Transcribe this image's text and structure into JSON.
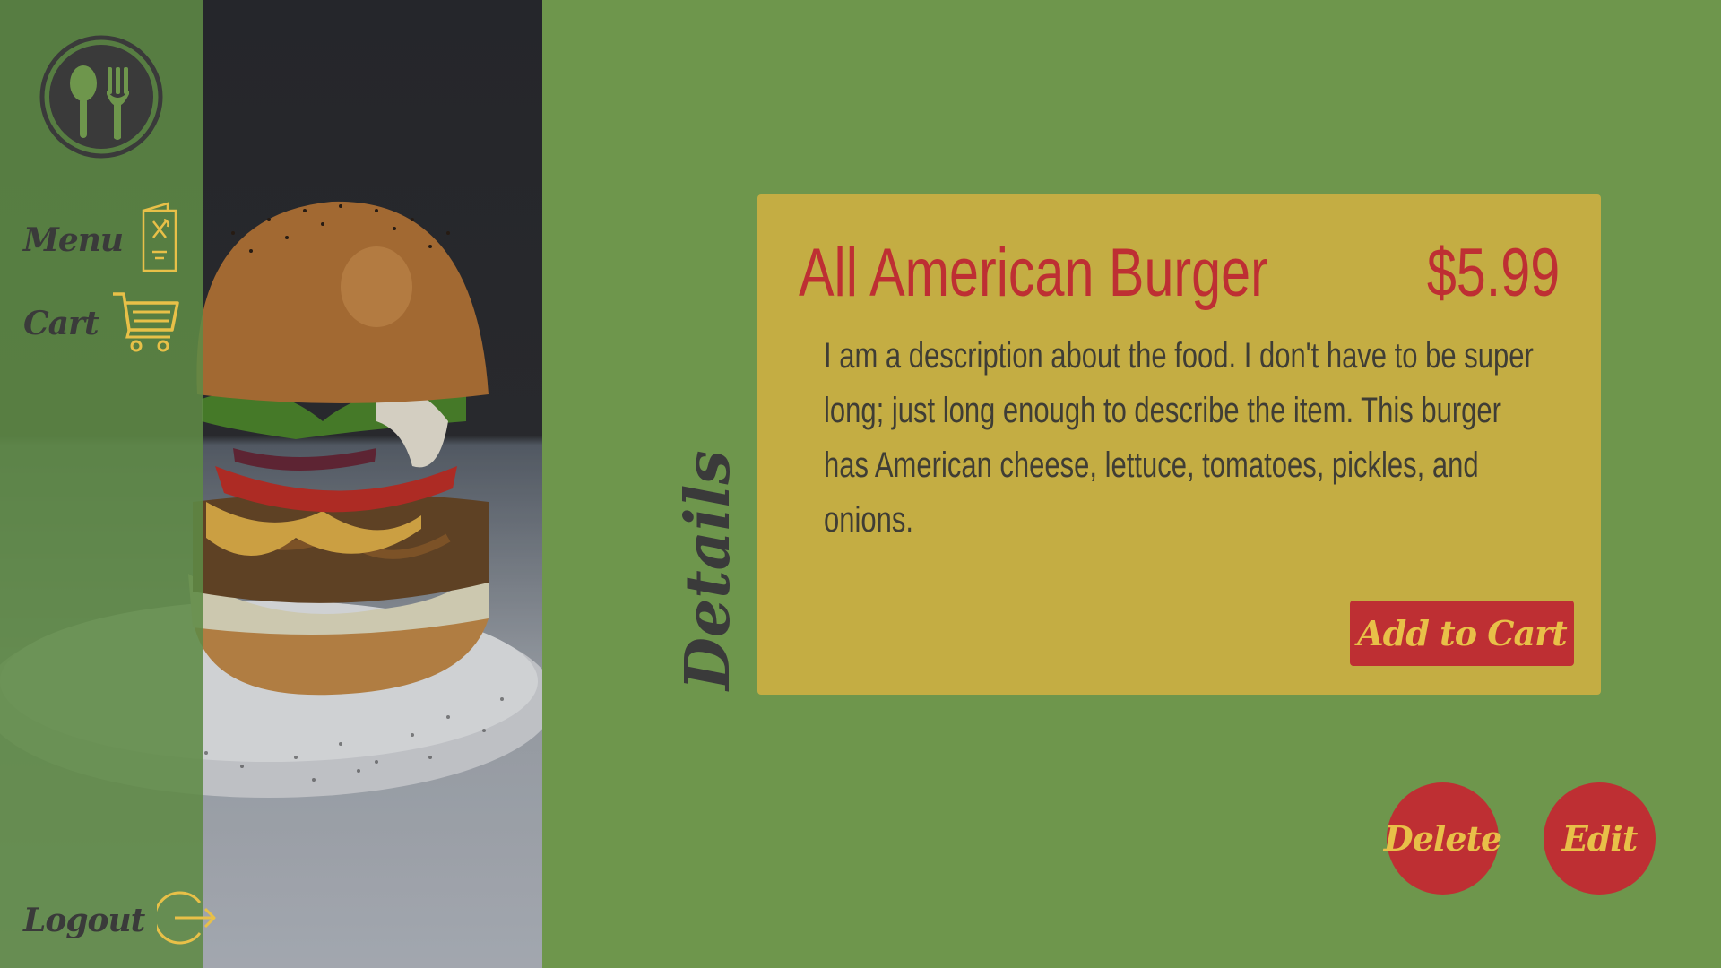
{
  "sidebar": {
    "logo_icon": "spoon-fork-icon",
    "nav": [
      {
        "label": "Menu",
        "icon": "menu-card-icon"
      },
      {
        "label": "Cart",
        "icon": "shopping-cart-icon"
      }
    ],
    "logout": {
      "label": "Logout",
      "icon": "logout-arrow-icon"
    }
  },
  "main": {
    "section_title": "Details",
    "item": {
      "name": "All American Burger",
      "price": "$5.99",
      "description": "I am a description about the food. I don't have to be super long; just long enough to describe the item. This burger has American cheese, lettuce, tomatoes, pickles, and onions."
    },
    "add_to_cart_label": "Add to Cart",
    "delete_label": "Delete",
    "edit_label": "Edit"
  },
  "colors": {
    "background": "#6e964c",
    "sidebar": "#5f8a46",
    "card": "#c4ad43",
    "accent_red": "#be2f33",
    "accent_yellow": "#e8c048",
    "text_dark": "#3a3a3a"
  }
}
